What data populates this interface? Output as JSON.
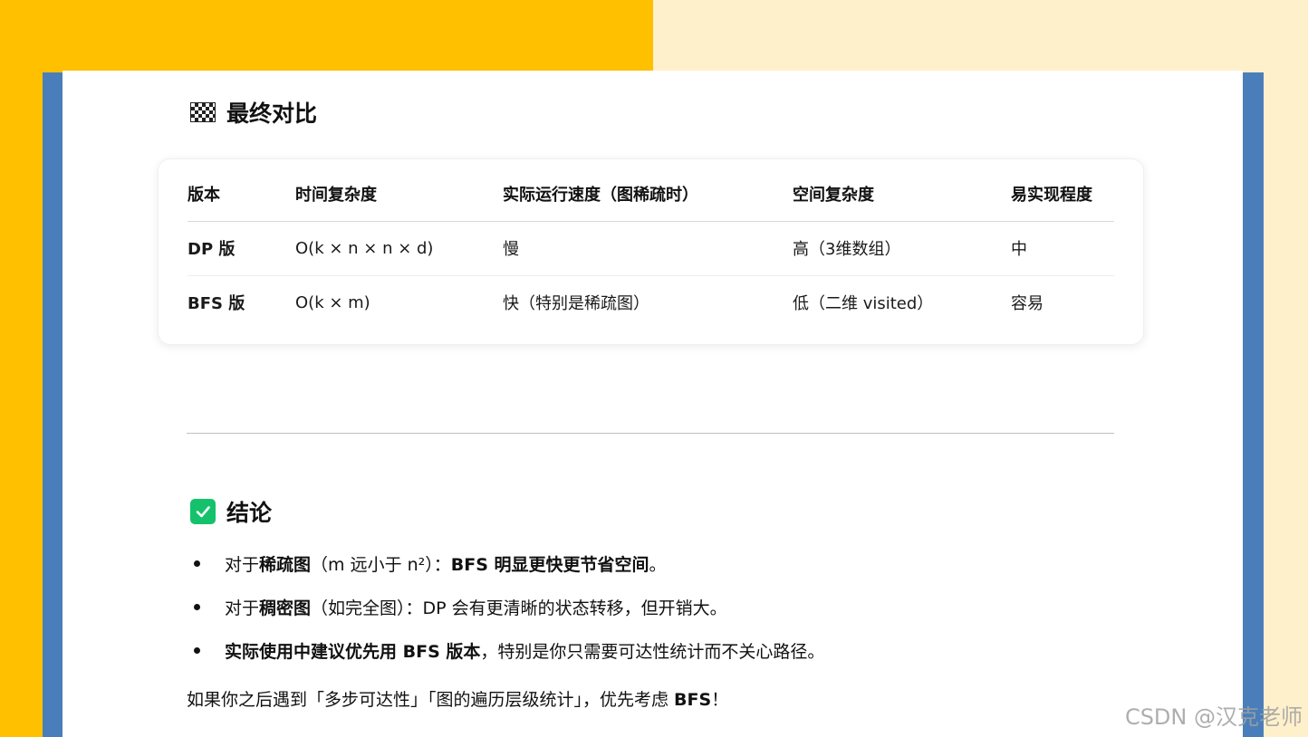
{
  "section1": {
    "title": "最终对比",
    "icon": "checkered-flag-icon"
  },
  "table": {
    "headers": [
      "版本",
      "时间复杂度",
      "实际运行速度（图稀疏时）",
      "空间复杂度",
      "易实现程度"
    ],
    "rows": [
      [
        "DP 版",
        "O(k × n × n × d)",
        "慢",
        "高（3维数组）",
        "中"
      ],
      [
        "BFS 版",
        "O(k × m)",
        "快（特别是稀疏图）",
        "低（二维 visited）",
        "容易"
      ]
    ]
  },
  "section2": {
    "title": "结论",
    "icon": "check-mark-icon",
    "icon_color": "#15C26B"
  },
  "bullets": [
    {
      "p1": "对于",
      "b1": "稀疏图",
      "p2": "（m 远小于 n²）：",
      "b2": "BFS 明显更快更节省空间",
      "p3": "。"
    },
    {
      "p1": "对于",
      "b1": "稠密图",
      "p2": "（如完全图）：DP 会有更清晰的状态转移，但开销大。",
      "b2": "",
      "p3": ""
    },
    {
      "p1": "",
      "b1": "实际使用中建议优先用 BFS 版本",
      "p2": "，特别是你只需要可达性统计而不关心路径。",
      "b2": "",
      "p3": ""
    }
  ],
  "final": {
    "text": "如果你之后遇到「多步可达性」「图的遍历层级统计」，优先考虑 ",
    "bold": "BFS",
    "end": "！"
  },
  "watermark": "CSDN @汉克老师",
  "colors": {
    "left_band": "#FFC000",
    "right_band": "#FFF0CC",
    "frame": "#4A7EBB"
  }
}
